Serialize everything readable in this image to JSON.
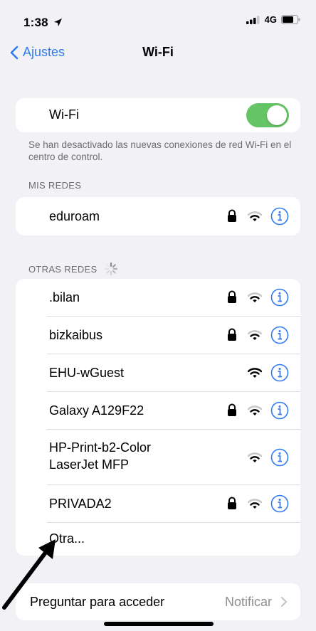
{
  "status_bar": {
    "time": "1:38",
    "network": "4G"
  },
  "nav": {
    "back_label": "Ajustes",
    "title": "Wi-Fi"
  },
  "wifi_toggle": {
    "label": "Wi-Fi",
    "on": true,
    "footnote": "Se han desactivado las nuevas conexiones de red Wi-Fi en el centro de control."
  },
  "my_networks": {
    "header": "MIS REDES",
    "items": [
      {
        "name": "eduroam",
        "locked": true
      }
    ]
  },
  "other_networks": {
    "header": "OTRAS REDES",
    "items": [
      {
        "name": ".bilan",
        "locked": true
      },
      {
        "name": "bizkaibus",
        "locked": true
      },
      {
        "name": "EHU-wGuest",
        "locked": false
      },
      {
        "name": "Galaxy A129F22",
        "locked": true
      },
      {
        "name_line1": "HP-Print-b2-Color",
        "name_line2": "LaserJet MFP",
        "locked": false
      },
      {
        "name": "PRIVADA2",
        "locked": true
      }
    ],
    "other_label": "Otra..."
  },
  "ask_to_join": {
    "label": "Preguntar para acceder",
    "value": "Notificar"
  },
  "colors": {
    "accent": "#2f7bf5",
    "toggle_on": "#65c466",
    "background": "#f1f1f6"
  }
}
